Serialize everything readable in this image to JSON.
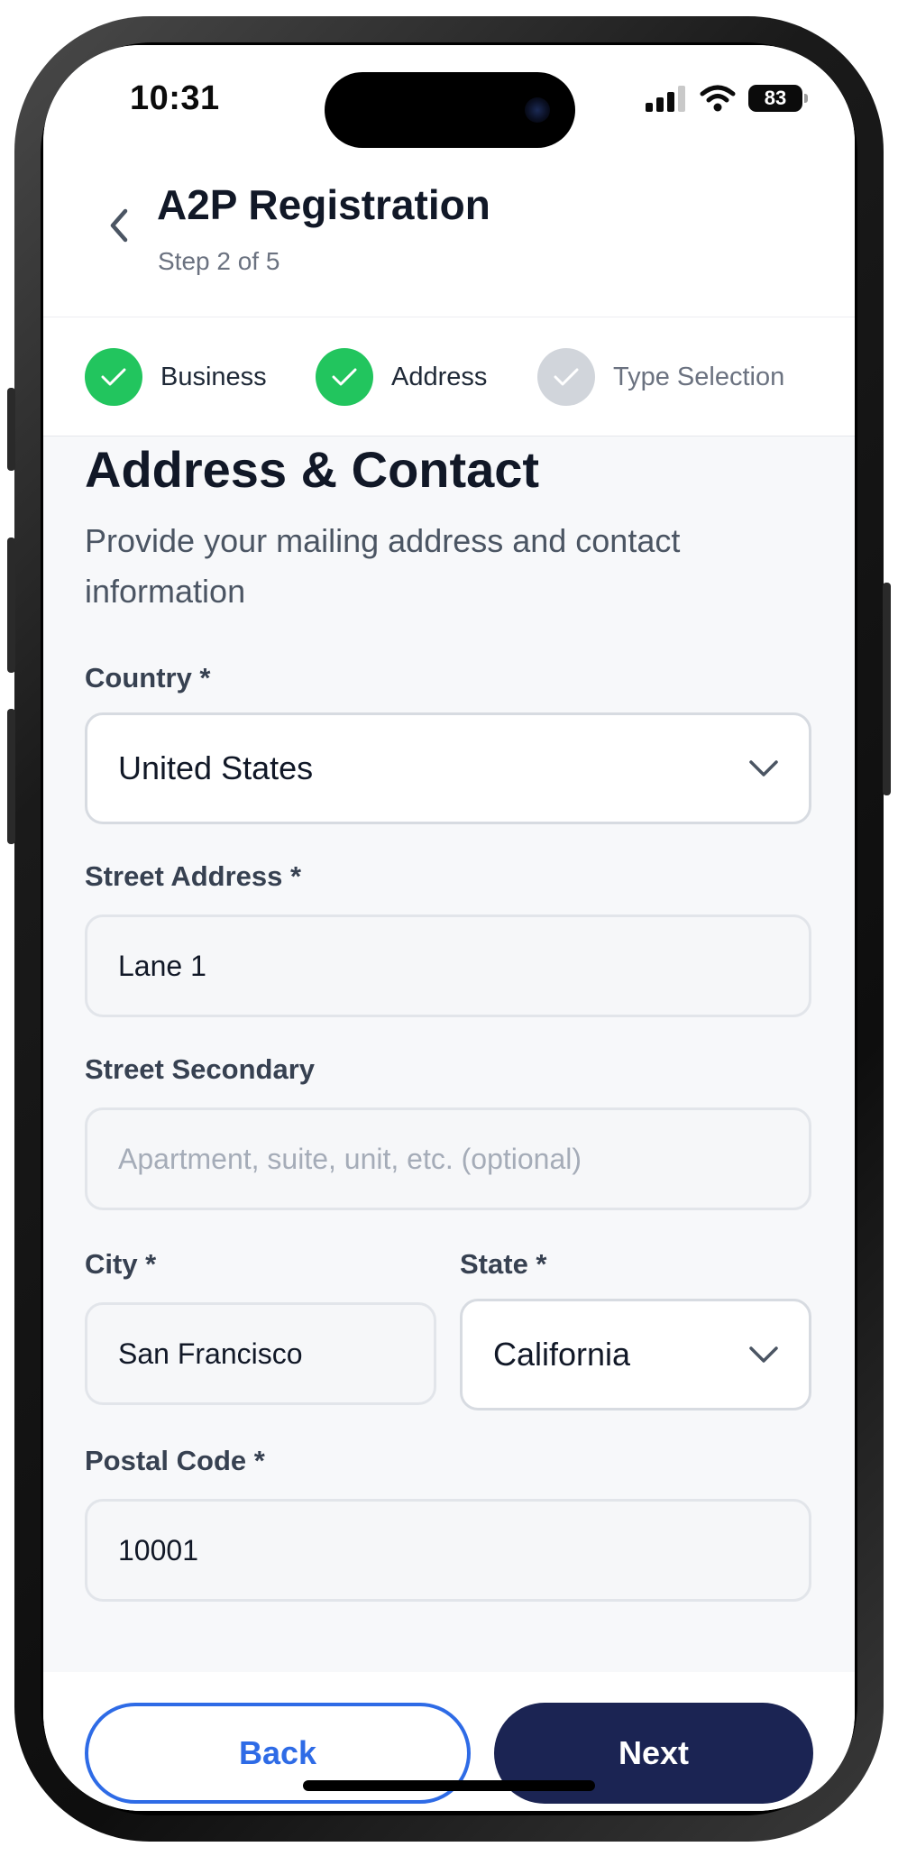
{
  "status_bar": {
    "time": "10:31",
    "battery": "83",
    "icons": [
      "signal-icon",
      "wifi-icon",
      "battery-icon"
    ]
  },
  "header": {
    "back_icon": "chevron-left-icon",
    "title": "A2P Registration",
    "subtitle": "Step 2 of 5"
  },
  "stepper": {
    "steps": [
      {
        "label": "Business",
        "state": "complete"
      },
      {
        "label": "Address",
        "state": "complete"
      },
      {
        "label": "Type Selection",
        "state": "pending"
      }
    ]
  },
  "form": {
    "title": "Address & Contact",
    "description": "Provide your mailing address and contact information",
    "country": {
      "label": "Country *",
      "value": "United States"
    },
    "street_address": {
      "label": "Street Address *",
      "value": "Lane 1"
    },
    "street_secondary": {
      "label": "Street Secondary",
      "value": "",
      "placeholder": "Apartment, suite, unit, etc. (optional)"
    },
    "city": {
      "label": "City *",
      "value": "San Francisco"
    },
    "state": {
      "label": "State *",
      "value": "California"
    },
    "postal_code": {
      "label": "Postal Code *",
      "value": "10001"
    }
  },
  "footer": {
    "back_label": "Back",
    "next_label": "Next"
  },
  "colors": {
    "success": "#22c55e",
    "pending": "#d1d5db",
    "primary_dark": "#1b2453",
    "primary_blue": "#2e6be6"
  }
}
